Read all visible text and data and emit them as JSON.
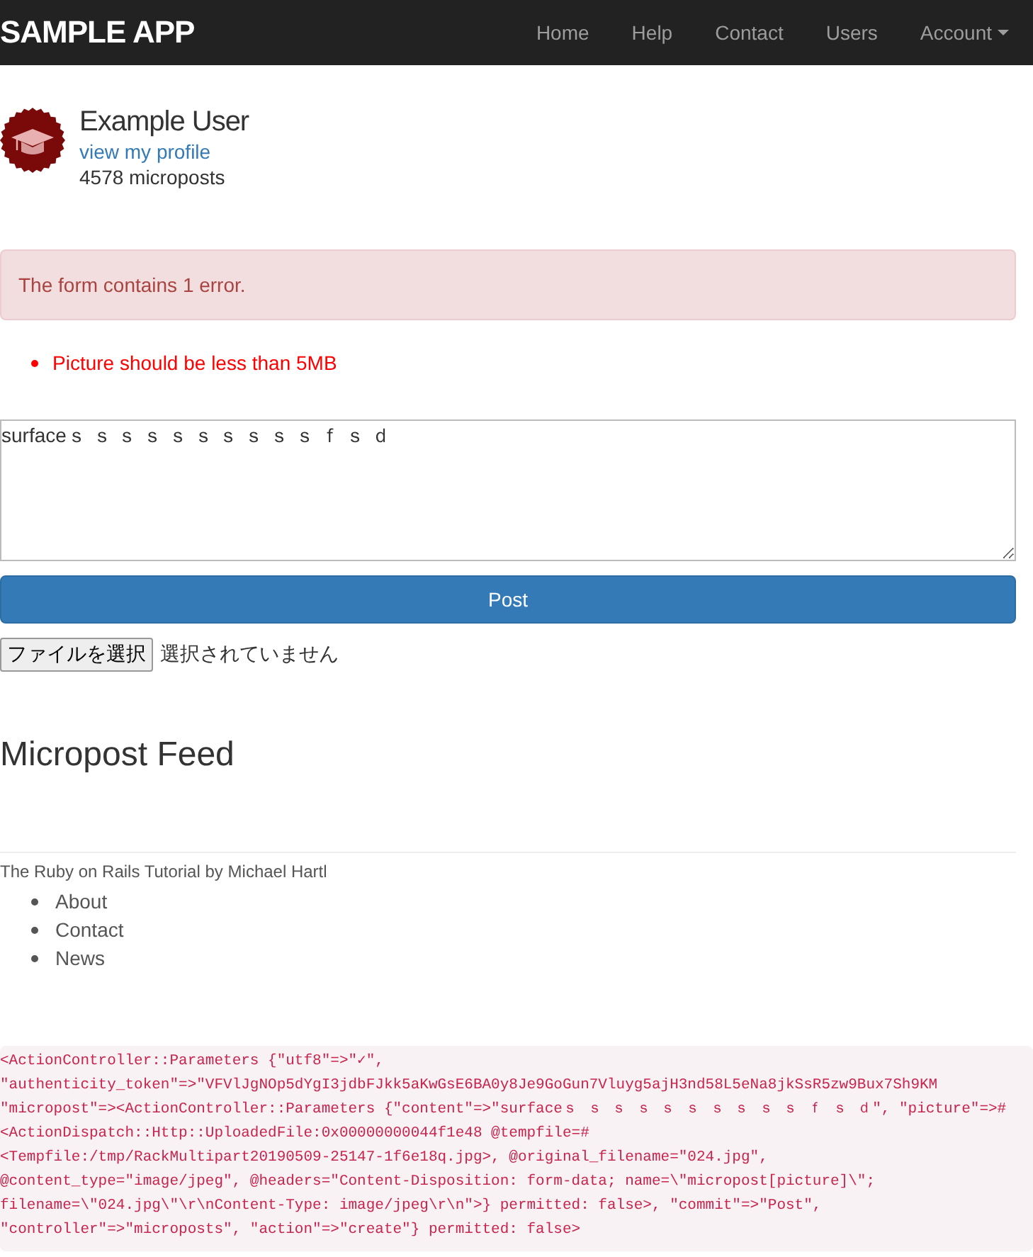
{
  "navbar": {
    "brand": "SAMPLE APP",
    "items": [
      {
        "label": "Home",
        "dropdown": false
      },
      {
        "label": "Help",
        "dropdown": false
      },
      {
        "label": "Contact",
        "dropdown": false
      },
      {
        "label": "Users",
        "dropdown": false
      },
      {
        "label": "Account",
        "dropdown": true
      }
    ]
  },
  "user": {
    "name": "Example User",
    "profile_link": "view my profile",
    "count": "4578 microposts"
  },
  "alert": "The form contains 1 error.",
  "errors": [
    "Picture should be less than 5MB"
  ],
  "form": {
    "content": "surfaceｓ ｓ ｓ ｓ ｓ ｓ ｓ ｓ ｓ ｓ ｆ ｓ ｄ",
    "submit": "Post",
    "file_button": "ファイルを選択",
    "file_status": "選択されていません"
  },
  "feed_title": "Micropost Feed",
  "footer": {
    "tutorial_link": "The Ruby on Rails Tutorial",
    "by": "by",
    "author_link": "Michael Hartl",
    "links": [
      "About",
      "Contact",
      "News"
    ]
  },
  "debug": [
    "<ActionController::Parameters {\"utf8\"=>\"✓\",",
    "\"authenticity_token\"=>\"VFVlJgNOp5dYgI3jdbFJkk5aKwGsE6BA0y8Je9GoGun7Vluyg5ajH3nd58L5eNa8jkSsR5zw9Bux7Sh9KM",
    "\"micropost\"=><ActionController::Parameters {\"content\"=>\"surfaceｓ ｓ ｓ ｓ ｓ ｓ ｓ ｓ ｓ ｓ ｆ ｓ ｄ\", \"picture\"=>#",
    "<ActionDispatch::Http::UploadedFile:0x00000000044f1e48 @tempfile=#",
    "<Tempfile:/tmp/RackMultipart20190509-25147-1f6e18q.jpg>, @original_filename=\"024.jpg\",",
    "@content_type=\"image/jpeg\", @headers=\"Content-Disposition: form-data; name=\\\"micropost[picture]\\\";",
    "filename=\\\"024.jpg\\\"\\r\\nContent-Type: image/jpeg\\r\\n\">} permitted: false>, \"commit\"=>\"Post\",",
    "\"controller\"=>\"microposts\", \"action\"=>\"create\"} permitted: false>"
  ]
}
